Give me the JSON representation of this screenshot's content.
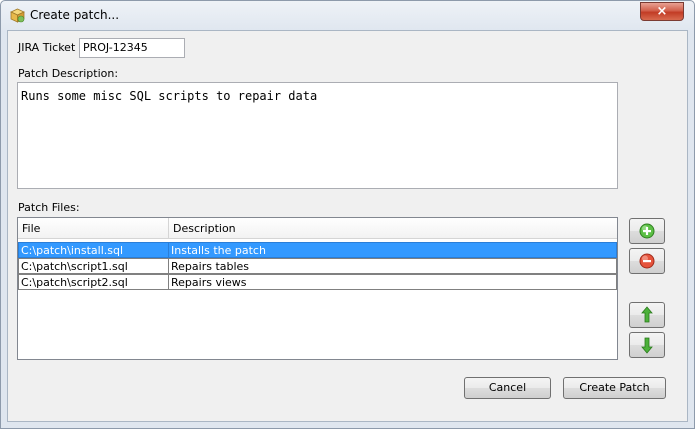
{
  "window": {
    "title": "Create patch...",
    "close_label": "×"
  },
  "form": {
    "jira_label": "JIRA Ticket",
    "jira_value": "PROJ-12345",
    "description_label": "Patch Description:",
    "description_value": "Runs some misc SQL scripts to repair data",
    "files_label": "Patch Files:"
  },
  "files_table": {
    "columns": [
      "File",
      "Description"
    ],
    "rows": [
      {
        "file": "C:\\patch\\install.sql",
        "description": "Installs the patch",
        "selected": true
      },
      {
        "file": "C:\\patch\\script1.sql",
        "description": "Repairs tables",
        "selected": false
      },
      {
        "file": "C:\\patch\\script2.sql",
        "description": "Repairs views",
        "selected": false
      }
    ]
  },
  "side_buttons": {
    "add_icon": "plus-circle-icon",
    "remove_icon": "minus-circle-icon",
    "up_icon": "arrow-up-icon",
    "down_icon": "arrow-down-icon"
  },
  "buttons": {
    "cancel_label": "Cancel",
    "create_label": "Create Patch"
  },
  "colors": {
    "selection": "#3399ff",
    "add_green": "#4caf3c",
    "remove_red": "#d9402c",
    "arrow_green": "#3aa12e"
  }
}
